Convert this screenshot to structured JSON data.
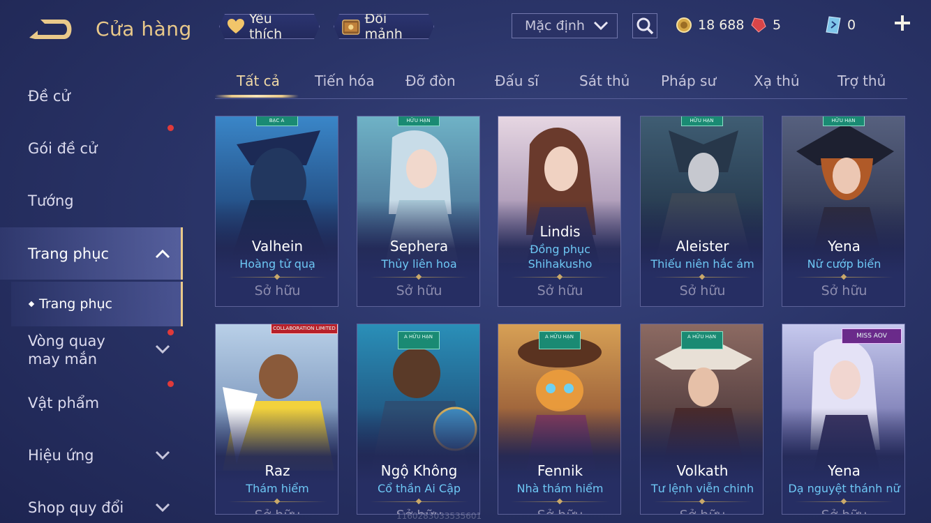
{
  "header": {
    "title": "Cửa hàng",
    "favorite_label": "Yêu thích",
    "fragment_label": "Đổi mảnh",
    "sort_value": "Mặc định",
    "gold": "18 688",
    "ruby": "5",
    "voucher": "0"
  },
  "sidebar": {
    "items": [
      {
        "label": "Đề cử"
      },
      {
        "label": "Gói đề cử"
      },
      {
        "label": "Tướng"
      },
      {
        "label": "Trang phục"
      },
      {
        "label": "Vòng quay may mắn"
      },
      {
        "label": "Vật phẩm"
      },
      {
        "label": "Hiệu ứng"
      },
      {
        "label": "Shop quy đổi"
      }
    ],
    "sub_item": "Trang phục"
  },
  "tabs": [
    "Tất cả",
    "Tiến hóa",
    "Đỡ đòn",
    "Đấu sĩ",
    "Sát thủ",
    "Pháp sư",
    "Xạ thủ",
    "Trợ thủ"
  ],
  "cards": [
    {
      "hero": "Valhein",
      "skin": "Hoàng tử quạ",
      "status": "Sở hữu",
      "badge": "BẠC A"
    },
    {
      "hero": "Sephera",
      "skin": "Thủy liên hoa",
      "status": "Sở hữu",
      "badge": "HỮU HẠN"
    },
    {
      "hero": "Lindis",
      "skin_line1": "Đồng phục",
      "skin_line2": "Shihakusho",
      "status": "Sở hữu"
    },
    {
      "hero": "Aleister",
      "skin": "Thiếu niên hắc ám",
      "status": "Sở hữu",
      "badge": "HỮU HẠN"
    },
    {
      "hero": "Yena",
      "skin": "Nữ cướp biển",
      "status": "Sở hữu",
      "badge": "HỮU HẠN"
    },
    {
      "hero": "Raz",
      "skin": "Thám hiểm",
      "status": "Sở hữu",
      "badge": "COLLABORATION LIMITED"
    },
    {
      "hero": "Ngộ Không",
      "skin": "Cổ thần Ai Cập",
      "status": "Sở hữu",
      "badge": "A HỮU HẠN"
    },
    {
      "hero": "Fennik",
      "skin": "Nhà thám hiểm",
      "status": "Sở hữu",
      "badge": "A HỮU HẠN"
    },
    {
      "hero": "Volkath",
      "skin": "Tư lệnh viễn chinh",
      "status": "Sở hữu",
      "badge": "A HỮU HẠN"
    },
    {
      "hero": "Yena",
      "skin": "Dạ nguyệt thánh nữ",
      "status": "Sở hữu",
      "badge": "MISS AOV"
    }
  ],
  "watermark": "1160283033535601",
  "colors": {
    "accent_gold": "#e9c98a",
    "skin_blue": "#6ec8f5",
    "notify_red": "#e03a3a"
  }
}
